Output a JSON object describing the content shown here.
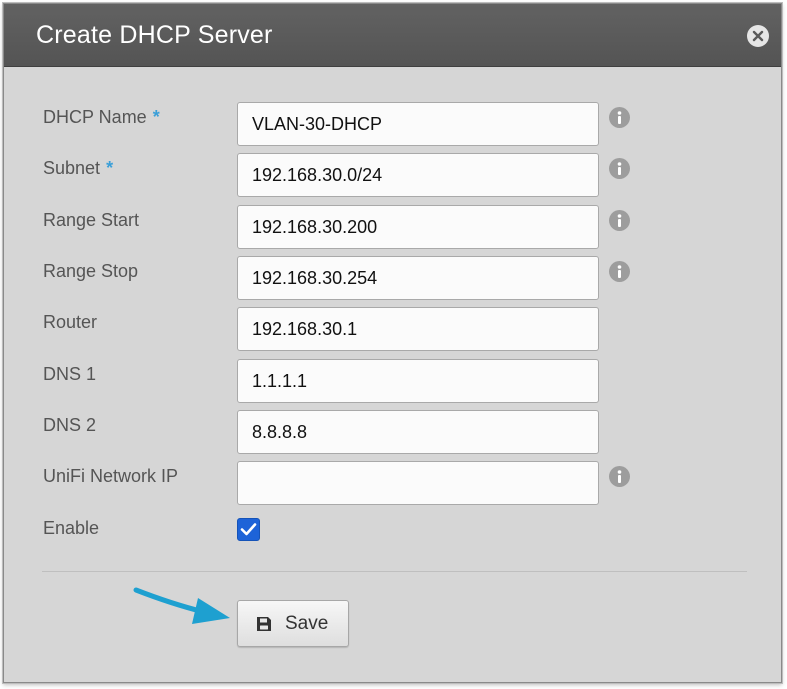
{
  "dialog": {
    "title": "Create DHCP Server",
    "close_icon": "close-icon"
  },
  "form": {
    "fields": [
      {
        "label": "DHCP Name",
        "required": true,
        "value": "VLAN-30-DHCP",
        "info": true
      },
      {
        "label": "Subnet",
        "required": true,
        "value": "192.168.30.0/24",
        "info": true
      },
      {
        "label": "Range Start",
        "required": false,
        "value": "192.168.30.200",
        "info": true
      },
      {
        "label": "Range Stop",
        "required": false,
        "value": "192.168.30.254",
        "info": true
      },
      {
        "label": "Router",
        "required": false,
        "value": "192.168.30.1",
        "info": false
      },
      {
        "label": "DNS 1",
        "required": false,
        "value": "1.1.1.1",
        "info": false
      },
      {
        "label": "DNS 2",
        "required": false,
        "value": "8.8.8.8",
        "info": false
      },
      {
        "label": "UniFi Network IP",
        "required": false,
        "value": "",
        "info": true
      }
    ],
    "required_marker": "*",
    "enable": {
      "label": "Enable",
      "checked": true
    }
  },
  "actions": {
    "save_label": "Save",
    "save_icon": "floppy-disk-icon"
  },
  "colors": {
    "header_bg": "#5a5a5a",
    "dialog_bg": "#d6d6d6",
    "required_star": "#3a9fd8",
    "checkbox": "#1d63d8",
    "arrow": "#1ea0d0"
  }
}
